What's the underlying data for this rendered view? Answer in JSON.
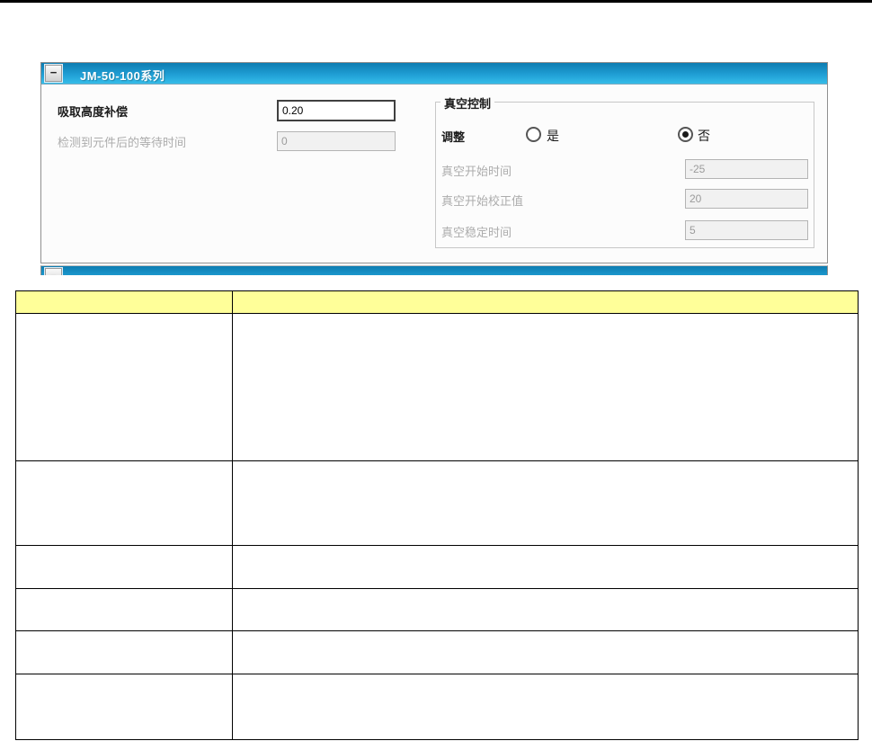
{
  "panel": {
    "title": "JM-50-100系列",
    "collapse_glyph": "−",
    "fields": {
      "pickup_height_label": "吸取高度补偿",
      "pickup_height_value": "0.20",
      "wait_time_label": "检测到元件后的等待时间",
      "wait_time_value": "0"
    },
    "vacuum": {
      "group_title": "真空控制",
      "adjust_label": "调整",
      "yes_label": "是",
      "no_label": "否",
      "selected_option": "否",
      "start_time_label": "真空开始时间",
      "start_time_value": "-25",
      "start_correction_label": "真空开始校正值",
      "start_correction_value": "20",
      "stabilize_label": "真空稳定时间",
      "stabilize_value": "5"
    }
  },
  "second_panel": {
    "collapse_glyph": "−",
    "title": ""
  },
  "table": {
    "header": {
      "c1": "",
      "c2": ""
    },
    "rows": [
      {
        "c1": "",
        "c2": ""
      },
      {
        "c1": "",
        "c2": ""
      },
      {
        "c1": "",
        "c2": ""
      },
      {
        "c1": "",
        "c2": ""
      },
      {
        "c1": "",
        "c2": ""
      },
      {
        "c1": "",
        "c2": ""
      }
    ]
  },
  "colors": {
    "titlebar_top": "#0d7cb1",
    "titlebar_bottom": "#35bde9",
    "table_header_yellow": "#ffff99",
    "disabled_text": "#9b9b9b",
    "disabled_bg": "#f1f1f1",
    "enabled_border": "#404040"
  }
}
